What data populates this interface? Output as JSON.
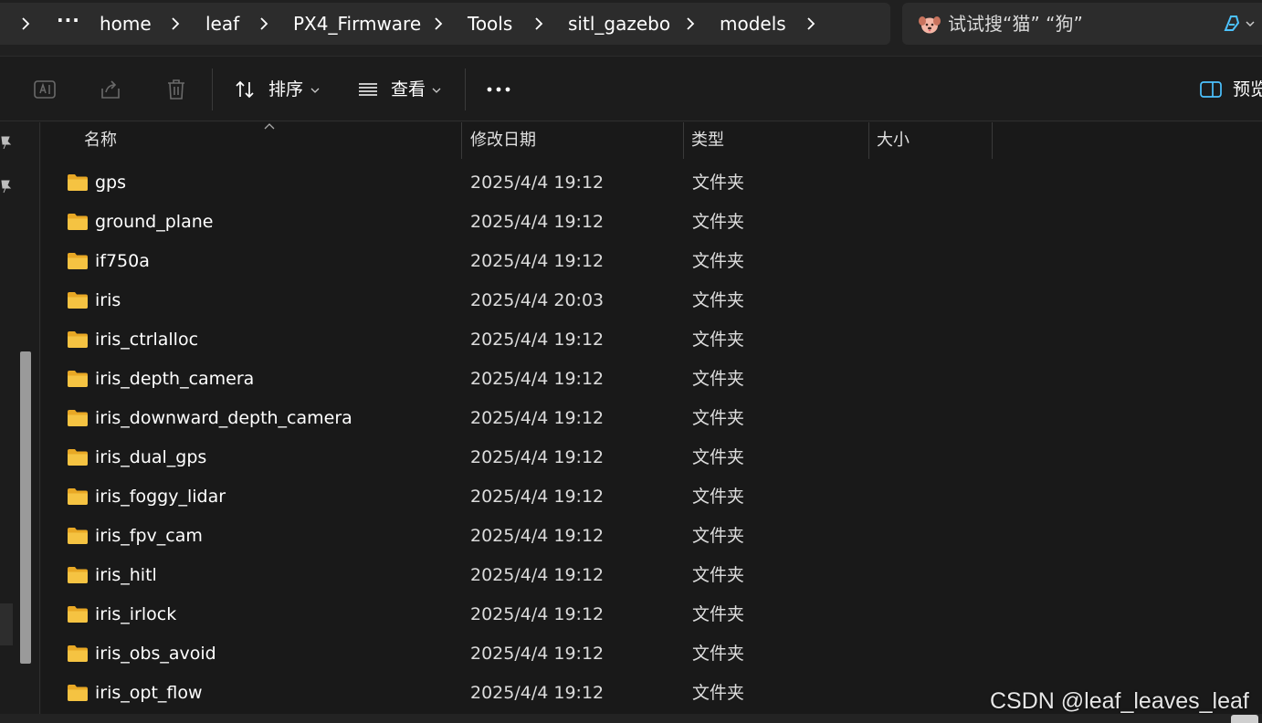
{
  "address_bar": {
    "more_label": "···",
    "breadcrumbs": [
      "home",
      "leaf",
      "PX4_Firmware",
      "Tools",
      "sitl_gazebo",
      "models"
    ]
  },
  "search": {
    "placeholder": "试试搜“猫” “狗”"
  },
  "command_bar": {
    "sort_label": "排序",
    "view_label": "查看",
    "more_label": "•••",
    "preview_label": "预览"
  },
  "columns": {
    "name": "名称",
    "date_modified": "修改日期",
    "type": "类型",
    "size": "大小"
  },
  "files": [
    {
      "name": "gps",
      "date": "2025/4/4 19:12",
      "type": "文件夹"
    },
    {
      "name": "ground_plane",
      "date": "2025/4/4 19:12",
      "type": "文件夹"
    },
    {
      "name": "if750a",
      "date": "2025/4/4 19:12",
      "type": "文件夹"
    },
    {
      "name": "iris",
      "date": "2025/4/4 20:03",
      "type": "文件夹"
    },
    {
      "name": "iris_ctrlalloc",
      "date": "2025/4/4 19:12",
      "type": "文件夹"
    },
    {
      "name": "iris_depth_camera",
      "date": "2025/4/4 19:12",
      "type": "文件夹"
    },
    {
      "name": "iris_downward_depth_camera",
      "date": "2025/4/4 19:12",
      "type": "文件夹"
    },
    {
      "name": "iris_dual_gps",
      "date": "2025/4/4 19:12",
      "type": "文件夹"
    },
    {
      "name": "iris_foggy_lidar",
      "date": "2025/4/4 19:12",
      "type": "文件夹"
    },
    {
      "name": "iris_fpv_cam",
      "date": "2025/4/4 19:12",
      "type": "文件夹"
    },
    {
      "name": "iris_hitl",
      "date": "2025/4/4 19:12",
      "type": "文件夹"
    },
    {
      "name": "iris_irlock",
      "date": "2025/4/4 19:12",
      "type": "文件夹"
    },
    {
      "name": "iris_obs_avoid",
      "date": "2025/4/4 19:12",
      "type": "文件夹"
    },
    {
      "name": "iris_opt_flow",
      "date": "2025/4/4 19:12",
      "type": "文件夹"
    }
  ],
  "watermark": "CSDN @leaf_leaves_leaf",
  "icons": {
    "toolbar": [
      "rename-icon",
      "share-icon",
      "delete-icon",
      "sort-icon",
      "view-icon",
      "preview-pane-icon"
    ],
    "folder": "folder-icon",
    "nav": [
      "pin-icon",
      "pin-icon"
    ]
  },
  "colors": {
    "background": "#191919",
    "folder_yellow": "#f5c342",
    "accent": "#4cc2ff",
    "disabled_icon": "#6a6a6a"
  }
}
